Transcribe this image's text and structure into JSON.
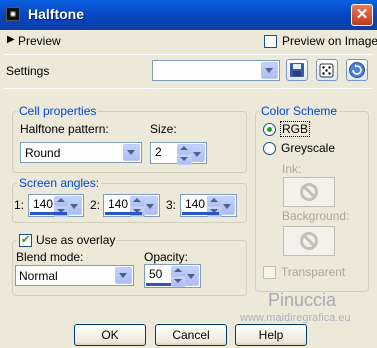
{
  "window": {
    "title": "Halftone",
    "close_symbol": "✕"
  },
  "preview": {
    "label": "Preview",
    "preview_on_image_label": "Preview on Image",
    "preview_on_image_checked": false
  },
  "settings": {
    "label": "Settings",
    "value": "",
    "icons": [
      "save-icon",
      "dice-icon",
      "reset-icon"
    ]
  },
  "cell_properties": {
    "group_label": "Cell properties",
    "pattern_label": "Halftone pattern:",
    "pattern_value": "Round",
    "size_label": "Size:",
    "size_value": "2"
  },
  "screen_angles": {
    "group_label": "Screen angles:",
    "items": [
      {
        "label": "1:",
        "value": "140"
      },
      {
        "label": "2:",
        "value": "140"
      },
      {
        "label": "3:",
        "value": "140"
      }
    ]
  },
  "overlay": {
    "use_label": "Use as overlay",
    "use_checked": true,
    "blend_label": "Blend mode:",
    "blend_value": "Normal",
    "opacity_label": "Opacity:",
    "opacity_value": "50"
  },
  "color_scheme": {
    "group_label": "Color Scheme",
    "rgb_label": "RGB",
    "greyscale_label": "Greyscale",
    "selected": "RGB",
    "ink_label": "Ink:",
    "background_label": "Background:",
    "transparent_label": "Transparent"
  },
  "buttons": {
    "ok": "OK",
    "cancel": "Cancel",
    "help": "Help"
  },
  "watermark": {
    "name": "Pinuccia",
    "url": "www.maidiregrafica.eu"
  }
}
